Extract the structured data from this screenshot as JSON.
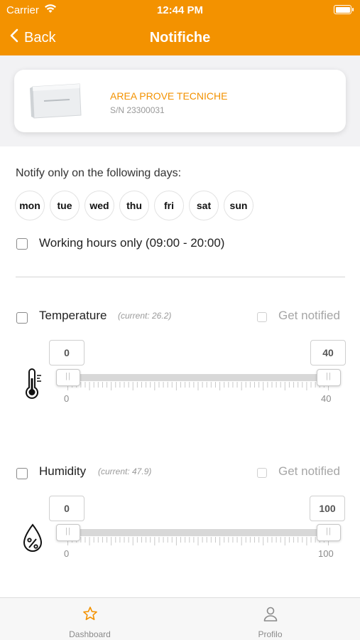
{
  "status_bar": {
    "carrier": "Carrier",
    "time": "12:44 PM"
  },
  "navbar": {
    "back_label": "Back",
    "title": "Notifiche"
  },
  "device": {
    "name": "AREA PROVE TECNICHE",
    "serial": "S/N 23300031"
  },
  "days": {
    "label": "Notify only on the following days:",
    "items": [
      "mon",
      "tue",
      "wed",
      "thu",
      "fri",
      "sat",
      "sun"
    ]
  },
  "working_hours": {
    "label": "Working hours only (09:00 - 20:00)",
    "checked": false
  },
  "sensors": [
    {
      "name": "Temperature",
      "current": "(current: 26.2)",
      "get_notified": "Get notified",
      "min_value": "0",
      "max_value": "40",
      "scale_min": "0",
      "scale_max": "40",
      "icon": "thermometer-icon"
    },
    {
      "name": "Humidity",
      "current": "(current: 47.9)",
      "get_notified": "Get notified",
      "min_value": "0",
      "max_value": "100",
      "scale_min": "0",
      "scale_max": "100",
      "icon": "humidity-drop-icon"
    }
  ],
  "tabbar": {
    "items": [
      {
        "label": "Dashboard",
        "icon": "star-icon"
      },
      {
        "label": "Profilo",
        "icon": "person-icon"
      }
    ]
  },
  "colors": {
    "accent": "#f39200",
    "background_gray": "#f2f2f4"
  }
}
